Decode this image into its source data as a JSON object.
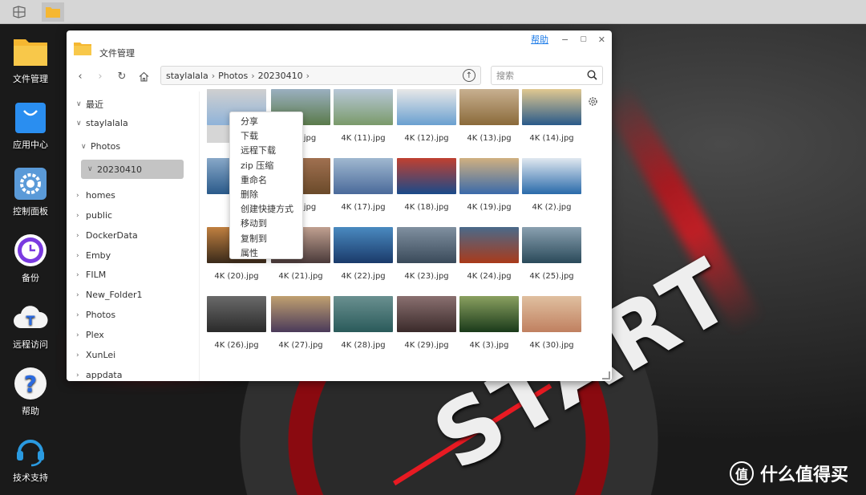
{
  "taskbar": {
    "items": [
      {
        "name": "desktop-view-icon",
        "active": false
      },
      {
        "name": "folder-icon",
        "active": true
      }
    ]
  },
  "desktop": {
    "icons": [
      {
        "label": "文件管理",
        "icon": "folder-icon"
      },
      {
        "label": "应用中心",
        "icon": "shopping-bag-icon"
      },
      {
        "label": "控制面板",
        "icon": "gear-icon"
      },
      {
        "label": "备份",
        "icon": "clock-icon"
      },
      {
        "label": "远程访问",
        "icon": "cloud-icon"
      },
      {
        "label": "帮助",
        "icon": "question-icon"
      },
      {
        "label": "技术支持",
        "icon": "headset-icon"
      }
    ]
  },
  "window": {
    "title": "文件管理",
    "help_label": "帮助",
    "path": [
      "staylalala",
      "Photos",
      "20230410"
    ],
    "search_placeholder": "搜索"
  },
  "sidebar": {
    "items": [
      {
        "label": "最近",
        "expanded": true,
        "level": 0
      },
      {
        "label": "staylalala",
        "expanded": true,
        "level": 0
      },
      {
        "label": "Photos",
        "expanded": true,
        "level": 1
      },
      {
        "label": "20230410",
        "expanded": true,
        "level": 2,
        "selected": true
      },
      {
        "label": "homes",
        "expanded": false,
        "level": 0
      },
      {
        "label": "public",
        "expanded": false,
        "level": 0
      },
      {
        "label": "DockerData",
        "expanded": false,
        "level": 0
      },
      {
        "label": "Emby",
        "expanded": false,
        "level": 0
      },
      {
        "label": "FILM",
        "expanded": false,
        "level": 0
      },
      {
        "label": "New_Folder1",
        "expanded": false,
        "level": 0
      },
      {
        "label": "Photos",
        "expanded": false,
        "level": 0
      },
      {
        "label": "Plex",
        "expanded": false,
        "level": 0
      },
      {
        "label": "XunLei",
        "expanded": false,
        "level": 0
      },
      {
        "label": "appdata",
        "expanded": false,
        "level": 0
      }
    ]
  },
  "files": [
    {
      "label": "4K",
      "c1": "#8fb3d9",
      "c2": "#d0d0d0"
    },
    {
      "label": "...0).jpg",
      "c1": "#5a7a4a",
      "c2": "#9bb0c0"
    },
    {
      "label": "4K (11).jpg",
      "c1": "#7a9a6a",
      "c2": "#b8c8d8"
    },
    {
      "label": "4K (12).jpg",
      "c1": "#6aa0d0",
      "c2": "#e8e8e8"
    },
    {
      "label": "4K (13).jpg",
      "c1": "#8a6a3a",
      "c2": "#c8b090"
    },
    {
      "label": "4K (14).jpg",
      "c1": "#2a5a8a",
      "c2": "#e0c890"
    },
    {
      "label": "4K",
      "c1": "#2a5a8a",
      "c2": "#88a8c8"
    },
    {
      "label": "...6).jpg",
      "c1": "#6a4a2a",
      "c2": "#a07050"
    },
    {
      "label": "4K (17).jpg",
      "c1": "#4a6a9a",
      "c2": "#a0b8d0"
    },
    {
      "label": "4K (18).jpg",
      "c1": "#1a4a8a",
      "c2": "#c04030"
    },
    {
      "label": "4K (19).jpg",
      "c1": "#3a6aaa",
      "c2": "#d0b080"
    },
    {
      "label": "4K (2).jpg",
      "c1": "#2a6aaa",
      "c2": "#e0e8f0"
    },
    {
      "label": "4K (20).jpg",
      "c1": "#3a2a1a",
      "c2": "#c08040"
    },
    {
      "label": "4K (21).jpg",
      "c1": "#4a3a3a",
      "c2": "#c0a090"
    },
    {
      "label": "4K (22).jpg",
      "c1": "#1a3a6a",
      "c2": "#4a8ac0"
    },
    {
      "label": "4K (23).jpg",
      "c1": "#3a4a5a",
      "c2": "#8090a0"
    },
    {
      "label": "4K (24).jpg",
      "c1": "#aa3a1a",
      "c2": "#4a6a8a"
    },
    {
      "label": "4K (25).jpg",
      "c1": "#2a4a5a",
      "c2": "#8aa0b0"
    },
    {
      "label": "4K (26).jpg",
      "c1": "#2a2a2a",
      "c2": "#6a6a6a"
    },
    {
      "label": "4K (27).jpg",
      "c1": "#4a3a5a",
      "c2": "#c0a070"
    },
    {
      "label": "4K (28).jpg",
      "c1": "#2a5a5a",
      "c2": "#6a9090"
    },
    {
      "label": "4K (29).jpg",
      "c1": "#3a2a2a",
      "c2": "#8a7070"
    },
    {
      "label": "4K (3).jpg",
      "c1": "#1a3a1a",
      "c2": "#8aa060"
    },
    {
      "label": "4K (30).jpg",
      "c1": "#c08060",
      "c2": "#e0c0a0"
    }
  ],
  "context_menu": {
    "items": [
      "分享",
      "下载",
      "远程下载",
      "zip 压缩",
      "重命名",
      "删除",
      "创建快捷方式",
      "移动到",
      "复制到",
      "属性"
    ]
  },
  "watermark": {
    "text": "什么值得买",
    "logo": "值"
  },
  "wallpaper": {
    "text": "START"
  },
  "colors": {
    "accent": "#1e7ce8",
    "folder": "#f5b731",
    "selected": "#c4c4c4"
  }
}
